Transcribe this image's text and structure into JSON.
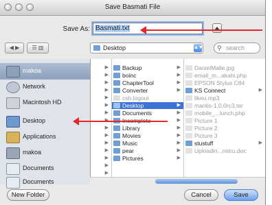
{
  "window": {
    "title": "Save Basmati File"
  },
  "save_as": {
    "label": "Save As:",
    "value": "Basmati.txt"
  },
  "toolbar": {
    "back_label": "◀",
    "forward_label": "▶",
    "view_label": "☰ ▥",
    "location": "Desktop",
    "search_placeholder": "search"
  },
  "sidebar": {
    "items": [
      {
        "label": "makoa",
        "icon": "drive-icon"
      },
      {
        "label": "Network",
        "icon": "network-icon"
      },
      {
        "label": "Macintosh HD",
        "icon": "hard-drive-icon"
      },
      {
        "label": "Desktop",
        "icon": "desktop-icon"
      },
      {
        "label": "Applications",
        "icon": "applications-icon"
      },
      {
        "label": "makoa",
        "icon": "home-icon"
      },
      {
        "label": "Documents",
        "icon": "documents-icon"
      },
      {
        "label": "Documents",
        "icon": "documents-icon"
      }
    ]
  },
  "columns": {
    "col1": [
      {
        "chev": "▶"
      },
      {
        "chev": "▶"
      },
      {
        "chev": "▶"
      },
      {
        "chev": "▶"
      },
      {
        "chev": "▶"
      },
      {
        "chev": "▶"
      },
      {
        "chev": "▶"
      },
      {
        "chev": "▶"
      },
      {
        "chev": "▶"
      },
      {
        "chev": "▶"
      },
      {
        "chev": "▶"
      },
      {
        "chev": "▶"
      },
      {
        "chev": "▶"
      },
      {
        "chev": "▶"
      },
      {
        "chev": "▶"
      },
      {
        "chev": "▶"
      }
    ],
    "col2": [
      {
        "label": "Backup",
        "chev": "▶"
      },
      {
        "label": "boinc",
        "chev": "▶"
      },
      {
        "label": "ChapterTool",
        "chev": "▶"
      },
      {
        "label": "Converter",
        "chev": "▶"
      },
      {
        "label": "csh.logout",
        "chev": ""
      },
      {
        "label": "Desktop",
        "chev": "▶"
      },
      {
        "label": "Documents",
        "chev": "▶"
      },
      {
        "label": "Incomplete",
        "chev": "▶"
      },
      {
        "label": "Library",
        "chev": "▶"
      },
      {
        "label": "Movies",
        "chev": "▶"
      },
      {
        "label": "Music",
        "chev": "▶"
      },
      {
        "label": "pear",
        "chev": "▶"
      },
      {
        "label": "Pictures",
        "chev": "▶"
      }
    ],
    "col3": [
      {
        "label": "DanielMalle.jpg",
        "chev": ""
      },
      {
        "label": "email_m...akahi.php",
        "chev": ""
      },
      {
        "label": "EPSON Stylus C84",
        "chev": ""
      },
      {
        "label": "KS Connect",
        "chev": "▶"
      },
      {
        "label": "likeu.mp3",
        "chev": ""
      },
      {
        "label": "mantis-1.0.0rc3.tar",
        "chev": ""
      },
      {
        "label": "mobile_...lunch.php",
        "chev": ""
      },
      {
        "label": "Picture 1",
        "chev": ""
      },
      {
        "label": "Picture 2",
        "chev": ""
      },
      {
        "label": "Picture 3",
        "chev": ""
      },
      {
        "label": "stustuff",
        "chev": "▶"
      },
      {
        "label": "Uploadin...nstru.doc",
        "chev": ""
      }
    ]
  },
  "buttons": {
    "new_folder": "New Folder",
    "cancel": "Cancel",
    "save": "Save"
  },
  "colors": {
    "selection": "#3d73d6",
    "annotation_arrow": "#e62626",
    "sidebar_bg": "#dfe4ea"
  }
}
